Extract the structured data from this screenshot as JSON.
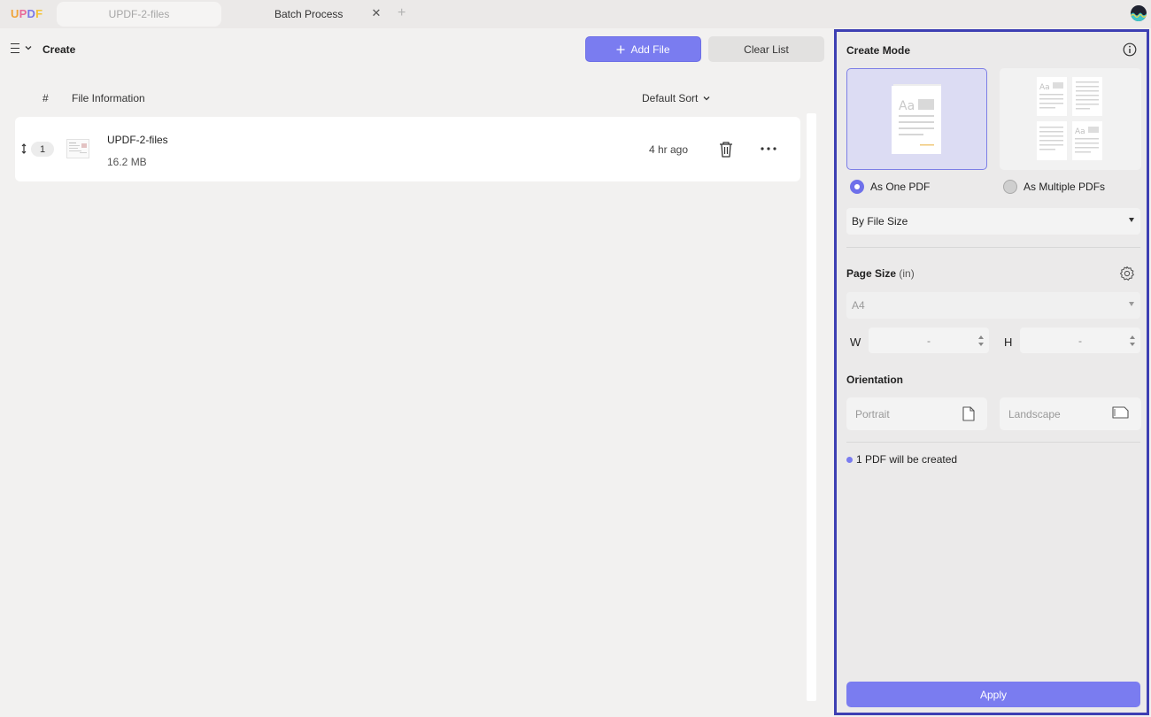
{
  "app": {
    "logo": "UPDF",
    "tabs": [
      {
        "label": "UPDF-2-files"
      },
      {
        "label": "Batch Process"
      }
    ]
  },
  "toolbar": {
    "section_label": "Create",
    "add_file_label": "Add File",
    "clear_list_label": "Clear List"
  },
  "file_list": {
    "columns": {
      "index": "#",
      "info": "File Information",
      "sort": "Default Sort"
    },
    "rows": [
      {
        "index": "1",
        "name": "UPDF-2-files",
        "size": "16.2 MB",
        "time": "4 hr ago"
      }
    ]
  },
  "panel": {
    "create_mode_title": "Create Mode",
    "mode_options": [
      {
        "label": "As One PDF",
        "selected": true
      },
      {
        "label": "As Multiple PDFs",
        "selected": false
      }
    ],
    "sort_select": "By File Size",
    "page_size": {
      "title": "Page Size",
      "unit": "(in)",
      "preset": "A4",
      "width_label": "W",
      "width_value": "-",
      "height_label": "H",
      "height_value": "-"
    },
    "orientation": {
      "title": "Orientation",
      "portrait": "Portrait",
      "landscape": "Landscape"
    },
    "status": "1 PDF will be created",
    "apply_label": "Apply"
  },
  "colors": {
    "accent": "#7a7cf0",
    "panel_border": "#3d3fb3"
  }
}
